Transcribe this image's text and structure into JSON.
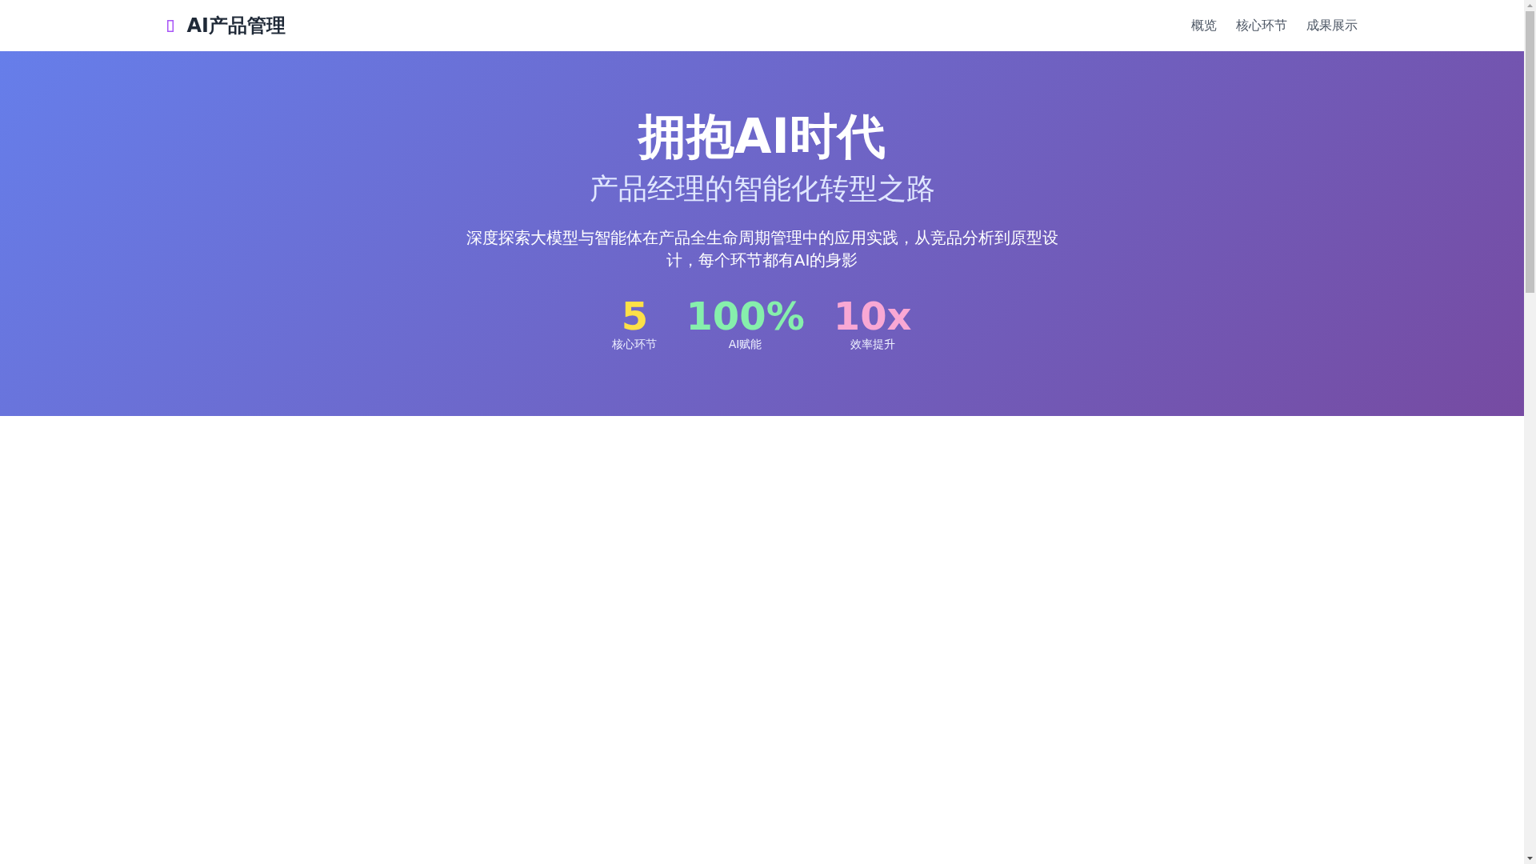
{
  "header": {
    "logo": {
      "text": "AI产品管理"
    },
    "nav": [
      {
        "label": "概览"
      },
      {
        "label": "核心环节"
      },
      {
        "label": "成果展示"
      }
    ]
  },
  "hero": {
    "title": "拥抱AI时代",
    "subtitle": "产品经理的智能化转型之路",
    "description": "深度探索大模型与智能体在产品全生命周期管理中的应用实践，从竞品分析到原型设计，每个环节都有AI的身影",
    "stats": [
      {
        "value": "5",
        "label": "核心环节",
        "color": "#fde047"
      },
      {
        "value": "100%",
        "label": "AI赋能",
        "color": "#86efac"
      },
      {
        "value": "10x",
        "label": "效率提升",
        "color": "#f9a8d4"
      }
    ]
  }
}
